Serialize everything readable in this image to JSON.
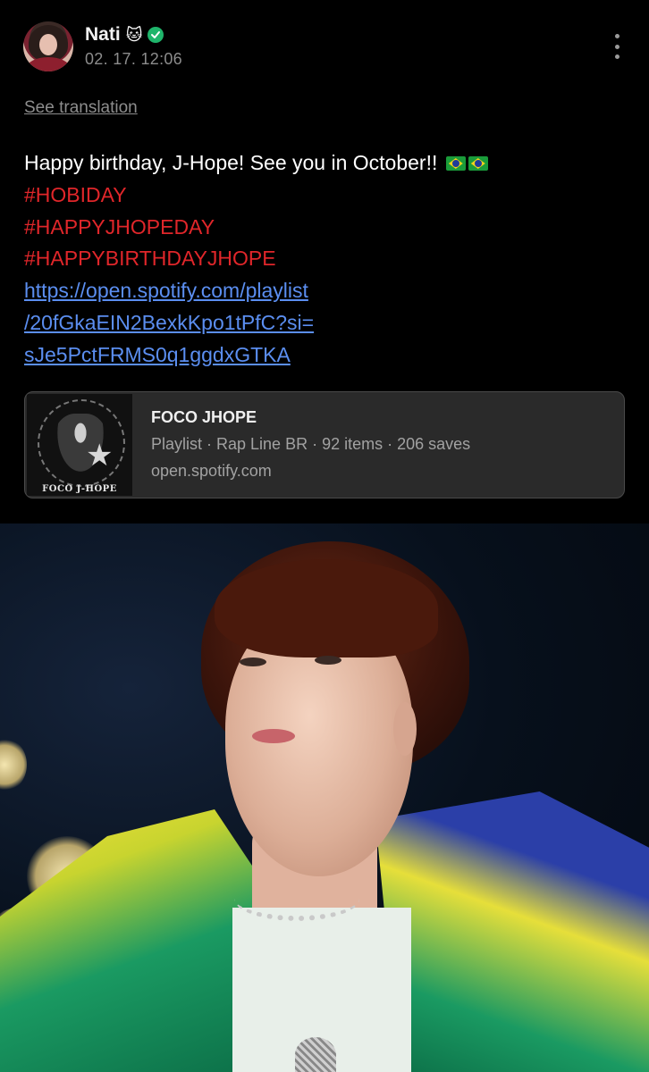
{
  "header": {
    "name": "Nati",
    "name_emoji": "🐱",
    "verified_icon": "verified-check-icon",
    "timestamp": "02. 17. 12:06",
    "more_icon": "vertical-dots-icon"
  },
  "see_translation": "See translation",
  "post": {
    "text_line": "Happy birthday, J-Hope! See you in October!!",
    "flags": "🇧🇷🇧🇷",
    "hashtags": [
      "#HOBIDAY",
      "#HAPPYJHOPEDAY",
      "#HAPPYBIRTHDAYJHOPE"
    ],
    "link_lines": [
      "https://open.spotify.com/playlist",
      "/20fGkaEIN2BexkKpo1tPfC?si=",
      "sJe5PctFRMS0q1ggdxGTKA"
    ]
  },
  "link_card": {
    "title": "FOCO JHOPE",
    "subtitle": "Playlist · Rap Line BR · 92 items · 206 saves",
    "domain": "open.spotify.com",
    "thumbnail_label": "FOCO J-HOPE"
  },
  "colors": {
    "background": "#000000",
    "hashtag": "#e0262a",
    "link": "#5b8ef0",
    "card_bg": "#2a2a2a",
    "verified": "#1fb56b"
  }
}
